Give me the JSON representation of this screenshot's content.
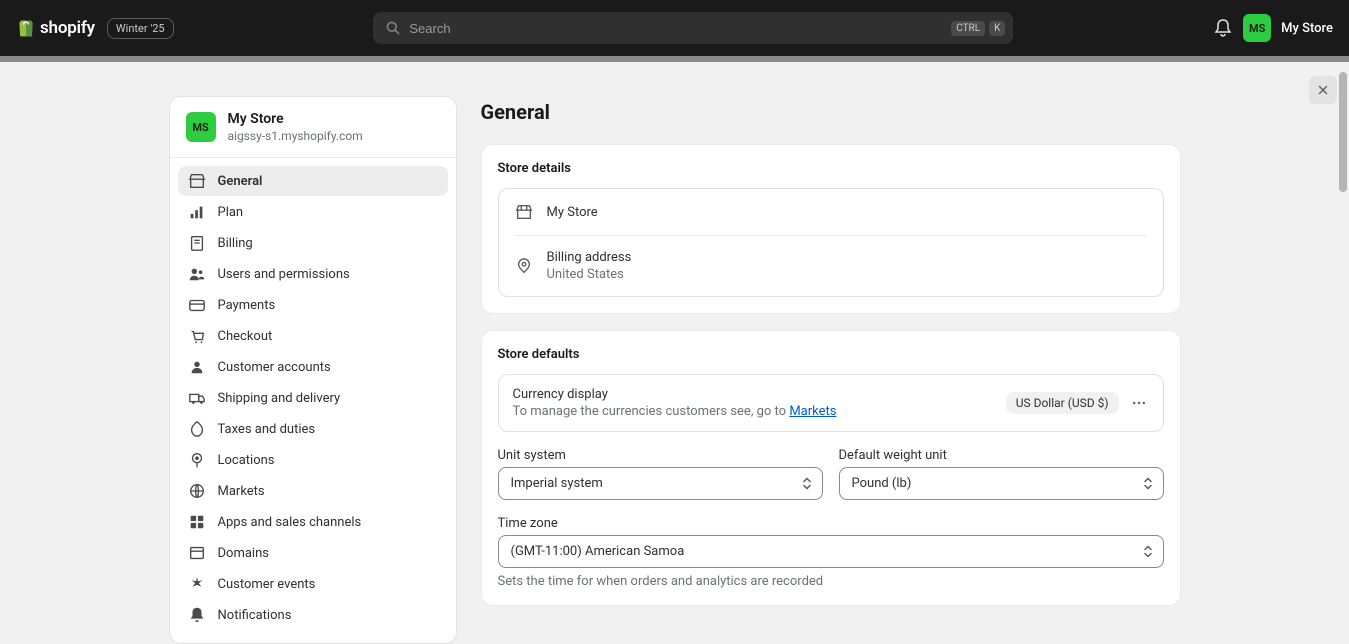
{
  "topbar": {
    "brand": "shopify",
    "badge": "Winter '25",
    "search_placeholder": "Search",
    "kbd1": "CTRL",
    "kbd2": "K",
    "avatar_initials": "MS",
    "store_name": "My Store"
  },
  "sidebar": {
    "avatar_initials": "MS",
    "store_name": "My Store",
    "domain": "aigssy-s1.myshopify.com",
    "items": [
      {
        "key": "general",
        "label": "General",
        "active": true
      },
      {
        "key": "plan",
        "label": "Plan"
      },
      {
        "key": "billing",
        "label": "Billing"
      },
      {
        "key": "users",
        "label": "Users and permissions"
      },
      {
        "key": "payments",
        "label": "Payments"
      },
      {
        "key": "checkout",
        "label": "Checkout"
      },
      {
        "key": "customer-accounts",
        "label": "Customer accounts"
      },
      {
        "key": "shipping",
        "label": "Shipping and delivery"
      },
      {
        "key": "taxes",
        "label": "Taxes and duties"
      },
      {
        "key": "locations",
        "label": "Locations"
      },
      {
        "key": "markets",
        "label": "Markets"
      },
      {
        "key": "apps",
        "label": "Apps and sales channels"
      },
      {
        "key": "domains",
        "label": "Domains"
      },
      {
        "key": "customer-events",
        "label": "Customer events"
      },
      {
        "key": "notifications",
        "label": "Notifications"
      }
    ]
  },
  "main": {
    "title": "General",
    "store_details": {
      "heading": "Store details",
      "name": "My Store",
      "billing_label": "Billing address",
      "billing_value": "United States"
    },
    "defaults": {
      "heading": "Store defaults",
      "currency_label": "Currency display",
      "currency_desc_prefix": "To manage the currencies customers see, go to ",
      "currency_link": "Markets",
      "currency_badge": "US Dollar (USD $)",
      "unit_label": "Unit system",
      "unit_value": "Imperial system",
      "weight_label": "Default weight unit",
      "weight_value": "Pound (lb)",
      "tz_label": "Time zone",
      "tz_value": "(GMT-11:00) American Samoa",
      "tz_helper": "Sets the time for when orders and analytics are recorded"
    }
  }
}
